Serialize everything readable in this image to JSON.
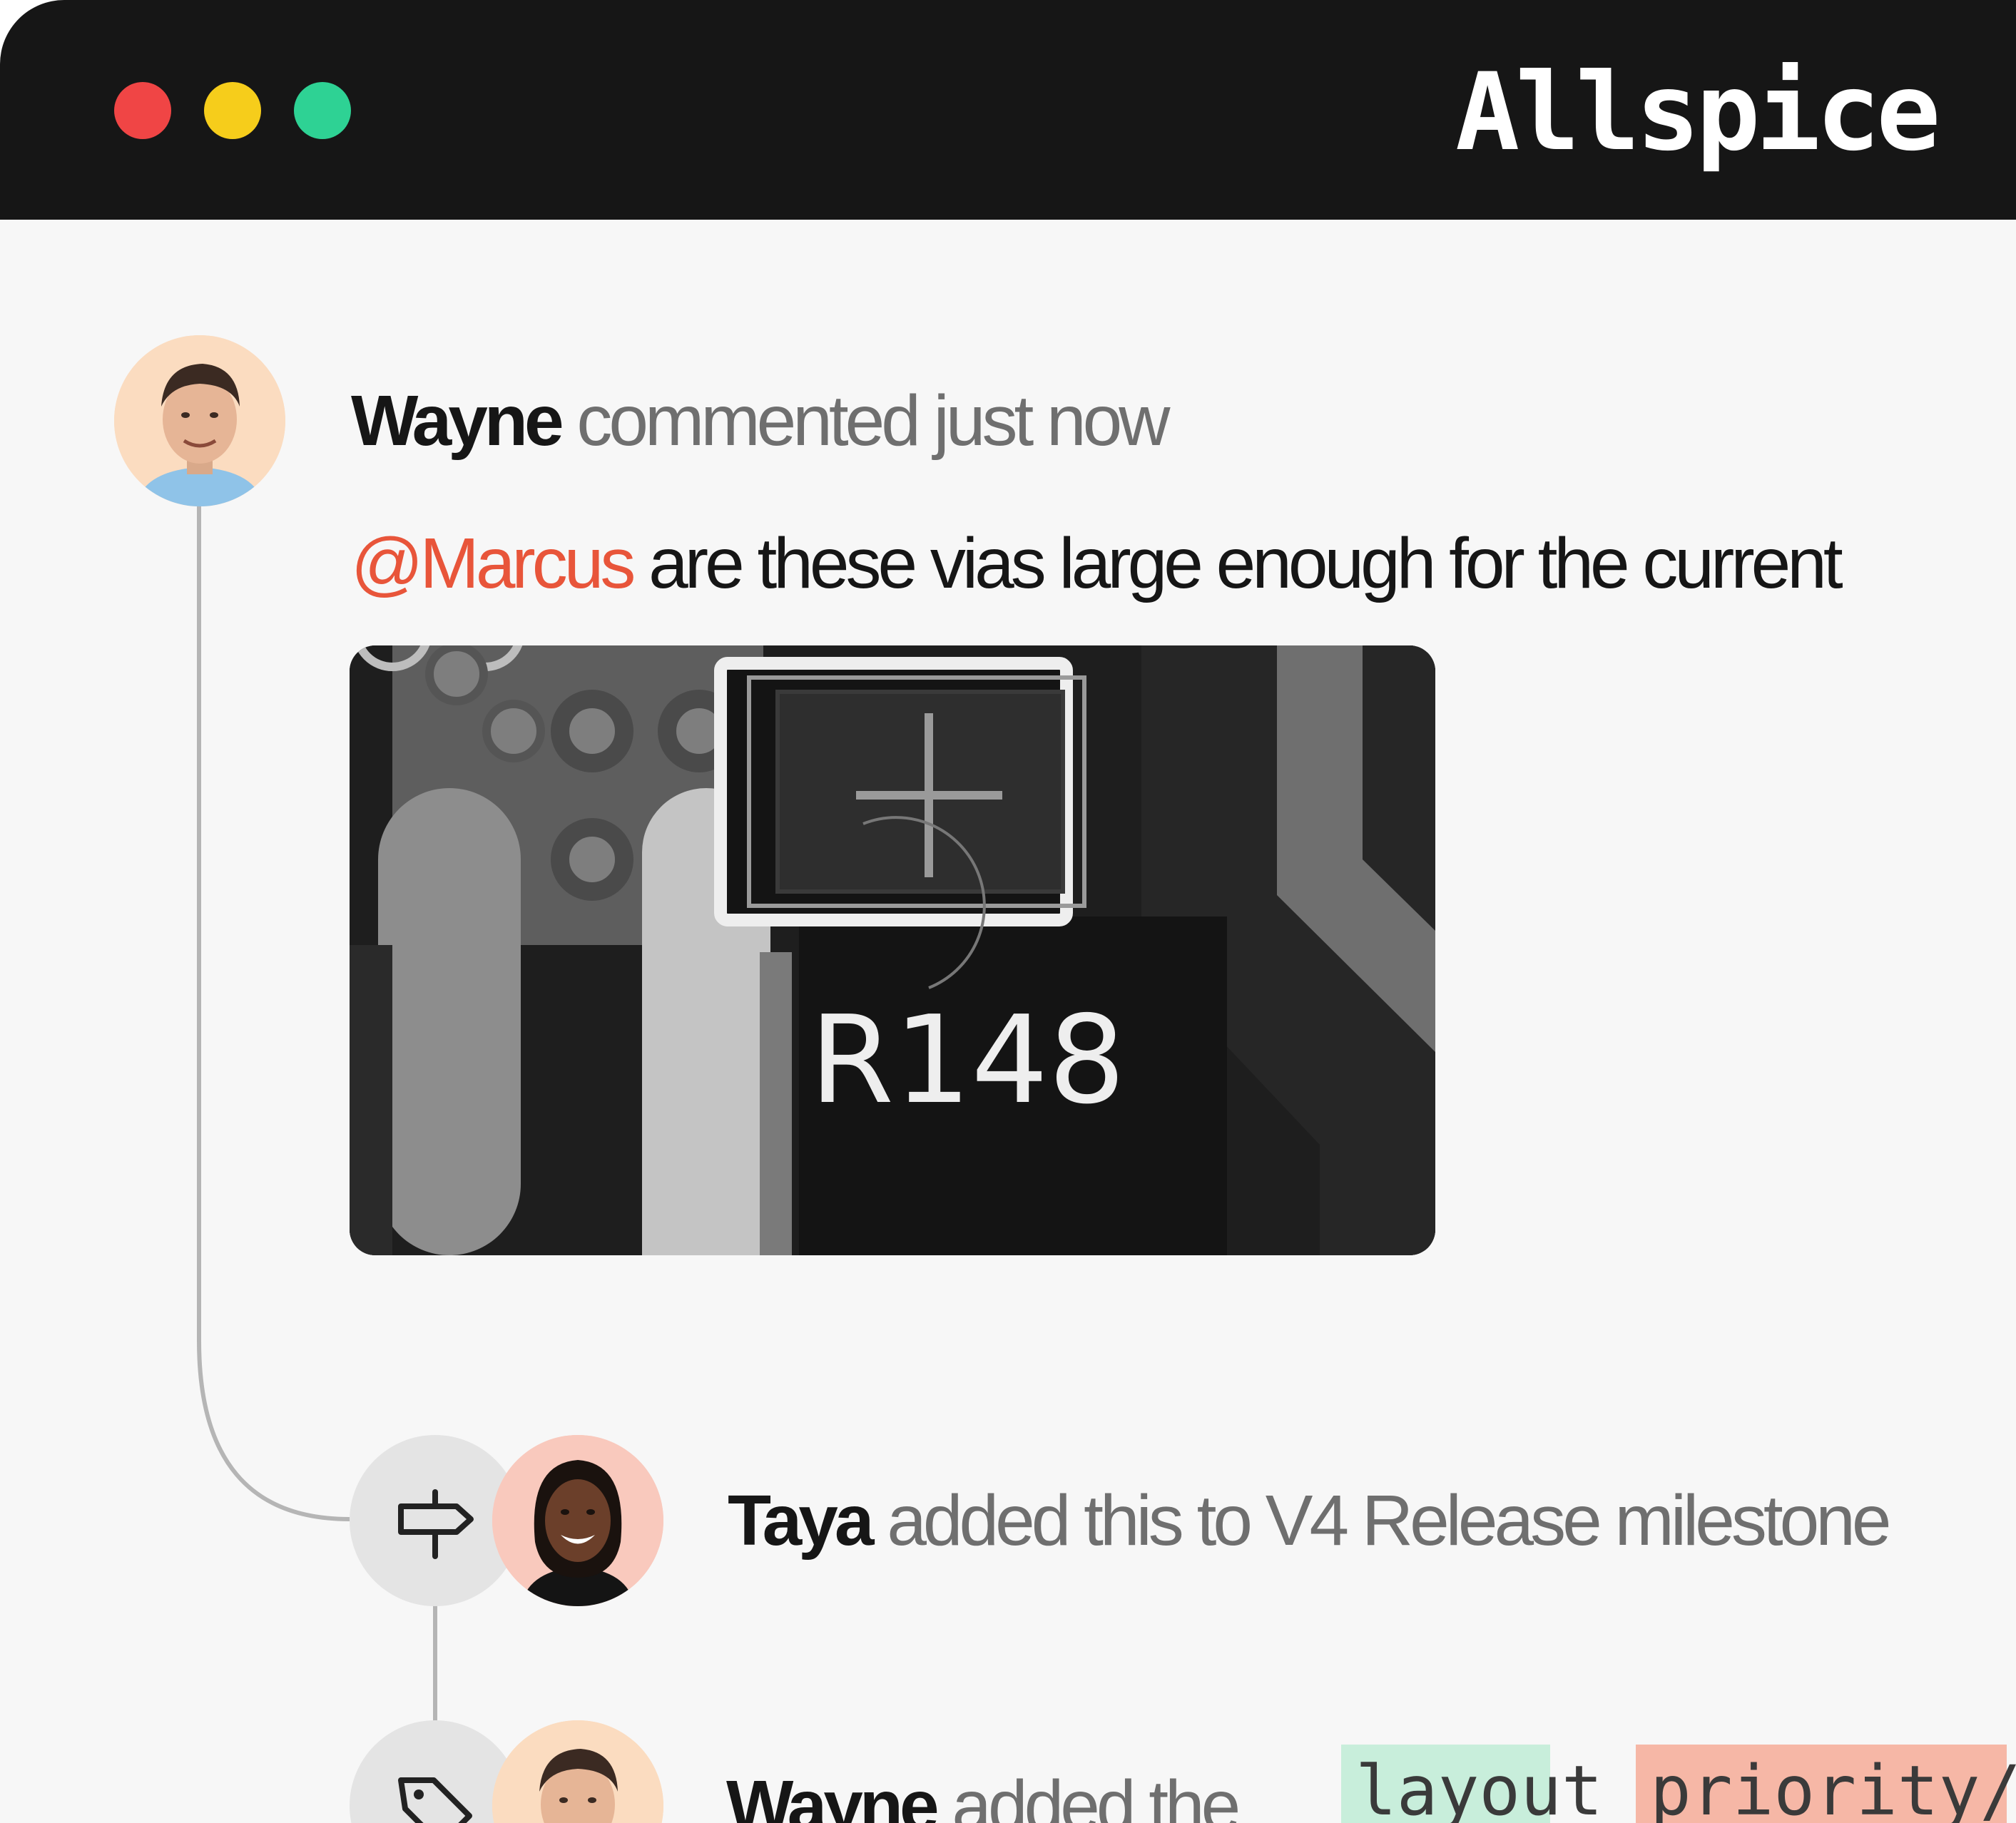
{
  "window": {
    "app_name": "Allspice",
    "traffic_lights": {
      "close": "#f04545",
      "minimize": "#f6cd1b",
      "maximize": "#2ed294"
    }
  },
  "comment": {
    "user": "Wayne",
    "action": "commented just now",
    "mention": "@Marcus",
    "text": "are these vias large enough for the current",
    "attachment": {
      "designator": "R148"
    }
  },
  "timeline": [
    {
      "icon": "signpost-icon",
      "user": "Taya",
      "action": "added this to V4 Release milestone"
    },
    {
      "icon": "tag-icon",
      "user": "Wayne",
      "action": "added the",
      "labels": [
        "layout",
        "priority/"
      ]
    }
  ],
  "colors": {
    "accent_mention": "#e8553a",
    "label_layout_bg": "#c8eedb",
    "label_priority_bg": "#f6b7a6",
    "avatar_wayne_bg": "#fbdcc0",
    "avatar_taya_bg": "#f9c9bd"
  }
}
